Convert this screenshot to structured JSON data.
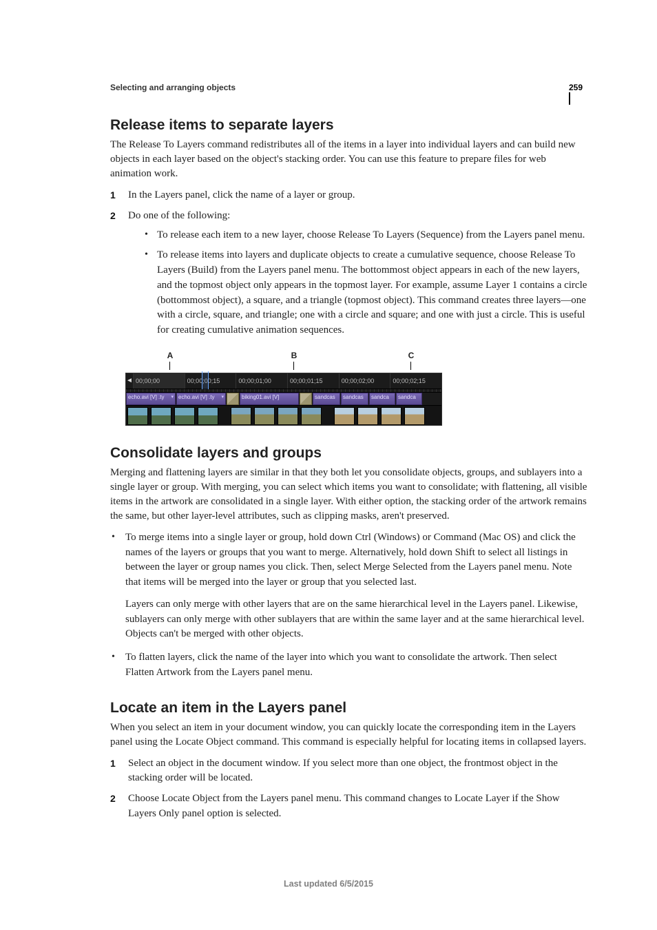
{
  "page_number": "259",
  "breadcrumb": "Selecting and arranging objects",
  "sections": {
    "release": {
      "title": "Release items to separate layers",
      "intro": "The Release To Layers command redistributes all of the items in a layer into individual layers and can build new objects in each layer based on the object's stacking order. You can use this feature to prepare files for web animation work.",
      "step1": "In the Layers panel, click the name of a layer or group.",
      "step2": "Do one of the following:",
      "step2_a": "To release each item to a new layer, choose Release To Layers (Sequence) from the Layers panel menu.",
      "step2_b": "To release items into layers and duplicate objects to create a cumulative sequence, choose Release To Layers (Build) from the Layers panel menu. The bottommost object appears in each of the new layers, and the topmost object only appears in the topmost layer. For example, assume Layer 1 contains a circle (bottommost object), a square, and a triangle (topmost object). This command creates three layers—one with a circle, square, and triangle; one with a circle and square; and one with just a circle. This is useful for creating cumulative animation sequences."
    },
    "figure": {
      "labels": {
        "a": "A",
        "b": "B",
        "c": "C"
      },
      "ruler": [
        "00;00;00",
        "00;00;00;15",
        "00;00;01;00",
        "00;00;01;15",
        "00;00;02;00",
        "00;00;02;15"
      ],
      "clips_row1": [
        "echo.avi [V] .ty",
        "echo.avi [V] .ty",
        "biking01.avi [V]",
        "sandcas",
        "sandcas",
        "sandca",
        "sandca"
      ]
    },
    "consolidate": {
      "title": "Consolidate layers and groups",
      "intro": "Merging and flattening layers are similar in that they both let you consolidate objects, groups, and sublayers into a single layer or group. With merging, you can select which items you want to consolidate; with flattening, all visible items in the artwork are consolidated in a single layer. With either option, the stacking order of the artwork remains the same, but other layer-level attributes, such as clipping masks, aren't preserved.",
      "bullet1": "To merge items into a single layer or group, hold down Ctrl (Windows) or Command (Mac OS) and click the names of the layers or groups that you want to merge. Alternatively, hold down Shift to select all listings in between the layer or group names you click. Then, select Merge Selected from the Layers panel menu. Note that items will be merged into the layer or group that you selected last.",
      "bullet1_sub": "Layers can only merge with other layers that are on the same hierarchical level in the Layers panel. Likewise, sublayers can only merge with other sublayers that are within the same layer and at the same hierarchical level. Objects can't be merged with other objects.",
      "bullet2": "To flatten layers, click the name of the layer into which you want to consolidate the artwork. Then select Flatten Artwork from the Layers panel menu."
    },
    "locate": {
      "title": "Locate an item in the Layers panel",
      "intro": "When you select an item in your document window, you can quickly locate the corresponding item in the Layers panel using the Locate Object command. This command is especially helpful for locating items in collapsed layers.",
      "step1": "Select an object in the document window. If you select more than one object, the frontmost object in the stacking order will be located.",
      "step2": "Choose Locate Object from the Layers panel menu. This command changes to Locate Layer if the Show Layers Only panel option is selected."
    }
  },
  "footer": "Last updated 6/5/2015"
}
